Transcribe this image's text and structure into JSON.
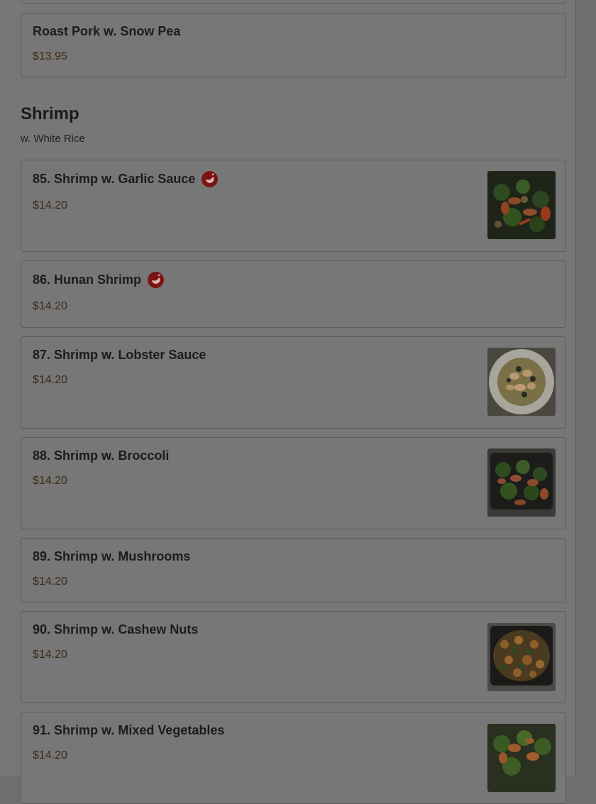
{
  "items_top": [
    {
      "name": "Roast Pork w. Snow Pea",
      "price": "$13.95"
    }
  ],
  "section": {
    "title": "Shrimp",
    "subtitle": "w. White Rice",
    "items": [
      {
        "name": "85. Shrimp w. Garlic Sauce",
        "price": "$14.20",
        "spicy": true,
        "image": "garlic-shrimp-photo"
      },
      {
        "name": "86. Hunan Shrimp",
        "price": "$14.20",
        "spicy": true
      },
      {
        "name": "87. Shrimp w. Lobster Sauce",
        "price": "$14.20",
        "image": "lobster-sauce-shrimp-photo"
      },
      {
        "name": "88. Shrimp w. Broccoli",
        "price": "$14.20",
        "image": "broccoli-shrimp-photo"
      },
      {
        "name": "89. Shrimp w. Mushrooms",
        "price": "$14.20"
      },
      {
        "name": "90. Shrimp w. Cashew Nuts",
        "price": "$14.20",
        "image": "cashew-shrimp-photo"
      },
      {
        "name": "91. Shrimp w. Mixed Vegetables",
        "price": "$14.20",
        "image": "mixed-veg-shrimp-photo"
      }
    ]
  },
  "icons": {
    "spicy": "spicy-pepper-icon"
  },
  "colors": {
    "spicy_badge": "#7a1412",
    "price_text": "#3b2a17",
    "overlay_bg": "#777777"
  }
}
